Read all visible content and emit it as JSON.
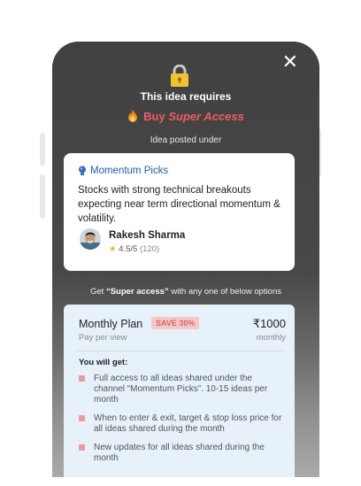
{
  "modal": {
    "requires_text": "This idea requires",
    "buy_text": "Buy ",
    "buy_emph": "Super Access",
    "posted_under": "Idea posted under"
  },
  "idea_card": {
    "category": "Momentum Picks",
    "description": "Stocks with strong technical breakouts expecting near term directional momentum & volatility.",
    "author": "Rakesh Sharma",
    "rating": "4.5/5",
    "rating_count": "(120)"
  },
  "get_line": {
    "prefix": "Get ",
    "emph": "“Super access”",
    "suffix": " with any one of below options"
  },
  "plan": {
    "title": "Monthly Plan",
    "badge": "SAVE 30%",
    "price": "₹1000",
    "pay_per_view": "Pay per view",
    "period": "monthly",
    "you_will_get": "You will get:",
    "benefits": [
      "Full access to all ideas shared under the channel “Momentum Picks”. 10-15 ideas per month",
      "When to enter & exit, target & stop loss price for all ideas shared during the month",
      "New updates for all ideas shared during the month"
    ]
  },
  "colors": {
    "accent_red": "#f15b5b",
    "link_blue": "#1a5fb4",
    "plan_bg": "#e6f1fa",
    "modal_dark": "#474747"
  }
}
